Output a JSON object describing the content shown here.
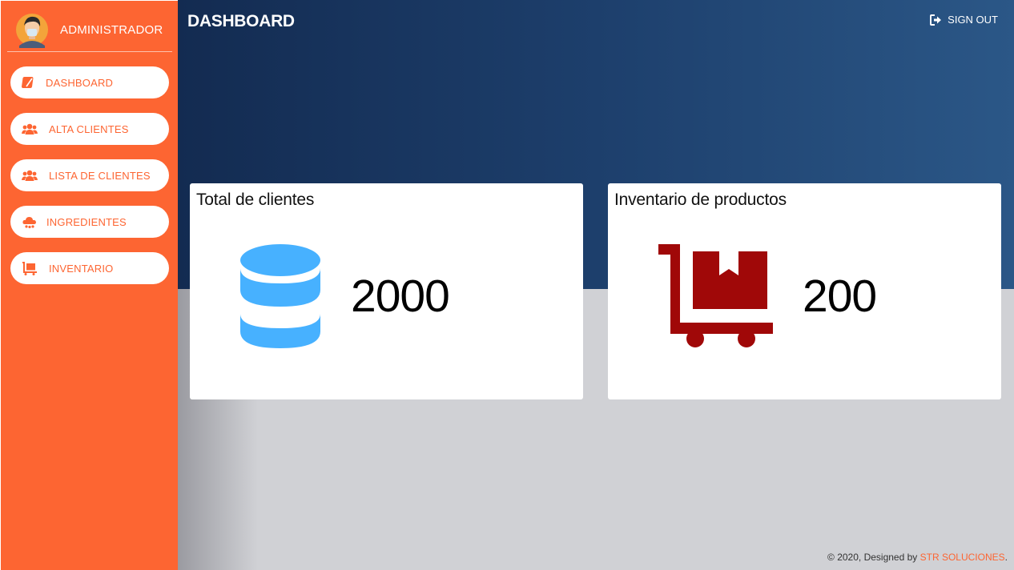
{
  "sidebar": {
    "user_name": "ADMINISTRADOR",
    "items": [
      {
        "label": "DASHBOARD",
        "icon": "leaf-icon"
      },
      {
        "label": "ALTA CLIENTES",
        "icon": "users-icon"
      },
      {
        "label": "LISTA DE CLIENTES",
        "icon": "users-icon"
      },
      {
        "label": "INGREDIENTES",
        "icon": "cloud-icon"
      },
      {
        "label": "INVENTARIO",
        "icon": "dolly-icon"
      }
    ]
  },
  "header": {
    "title": "DASHBOARD",
    "signout_label": "SIGN OUT"
  },
  "cards": [
    {
      "title": "Total de clientes",
      "value": "2000",
      "icon": "database-icon",
      "icon_color": "#47b1ff"
    },
    {
      "title": "Inventario de productos",
      "value": "200",
      "icon": "dolly-icon",
      "icon_color": "#a00808"
    }
  ],
  "footer": {
    "prefix": "© 2020, Designed by ",
    "brand": "STR SOLUCIONES",
    "suffix": "."
  },
  "colors": {
    "sidebar": "#fd6532",
    "header_dark": "#132b51",
    "header_light": "#2b5787",
    "background": "#d0d1d5"
  }
}
